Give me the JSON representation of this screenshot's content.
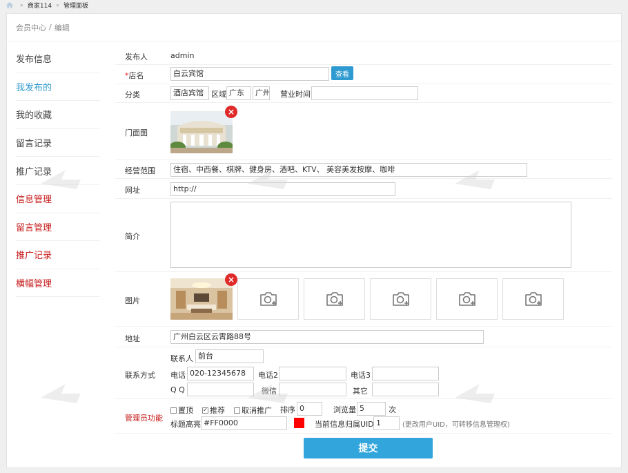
{
  "topbar": {
    "items": [
      "商家114",
      "管理面板"
    ],
    "sep": "»"
  },
  "breadcrumb": {
    "parent": "会员中心",
    "current": "编辑",
    "slash": "/"
  },
  "sidebar": {
    "items": [
      {
        "label": "发布信息"
      },
      {
        "label": "我发布的"
      },
      {
        "label": "我的收藏"
      },
      {
        "label": "留言记录"
      },
      {
        "label": "推广记录"
      },
      {
        "label": "信息管理"
      },
      {
        "label": "留言管理"
      },
      {
        "label": "推广记录"
      },
      {
        "label": "横幅管理"
      }
    ]
  },
  "form": {
    "publisher": {
      "label": "发布人",
      "value": "admin"
    },
    "shop_name": {
      "star": "*",
      "label": "店名",
      "value": "白云宾馆",
      "button": "查看"
    },
    "category": {
      "label": "分类",
      "value": "酒店宾馆",
      "region_label": "区域",
      "region1": "广东",
      "region2": "广州",
      "hours_label": "营业时间",
      "hours_value": ""
    },
    "storefront": {
      "label": "门面图",
      "delete": "×"
    },
    "scope": {
      "label": "经营范围",
      "value": "住宿、中西餐、棋牌、健身房、酒吧、KTV、 美容美发按摩、咖啡"
    },
    "website": {
      "label": "网址",
      "value": "http://"
    },
    "intro": {
      "label": "简介",
      "value": ""
    },
    "images": {
      "label": "图片",
      "delete": "×",
      "upload_slots": 5
    },
    "address": {
      "label": "地址",
      "value": "广州白云区云霄路88号"
    },
    "contact": {
      "label": "联系方式",
      "person_label": "联系人",
      "person_value": "前台",
      "phone_label": "电话",
      "phone_value": "020-12345678",
      "phone2_label": "电话2",
      "phone2_value": "",
      "phone3_label": "电话3",
      "phone3_value": "",
      "qq_label": "Q Q",
      "qq_value": "",
      "wechat_label": "微信",
      "wechat_value": "",
      "other_label": "其它",
      "other_value": ""
    },
    "admin": {
      "label": "管理员功能",
      "pin_label": "置顶",
      "pin_checked": false,
      "recommend_label": "推荐",
      "recommend_checked": true,
      "cancel_promo_label": "取消推广",
      "cancel_promo_checked": false,
      "sort_label": "排序",
      "sort_value": "0",
      "views_label": "浏览量",
      "views_value": "5",
      "views_unit": "次",
      "highlight_label": "标题高亮",
      "highlight_value": "#FF0000",
      "highlight_color": "#ff0000",
      "owner_uid_label": "当前信息归属UID",
      "owner_uid_value": "1",
      "owner_uid_hint": "(更改用户UID，可转移信息管理权)"
    }
  },
  "submit_label": "提交",
  "colors": {
    "accent": "#2e9ad0",
    "admin_red": "#c81e1e",
    "submit": "#32a6dc"
  }
}
